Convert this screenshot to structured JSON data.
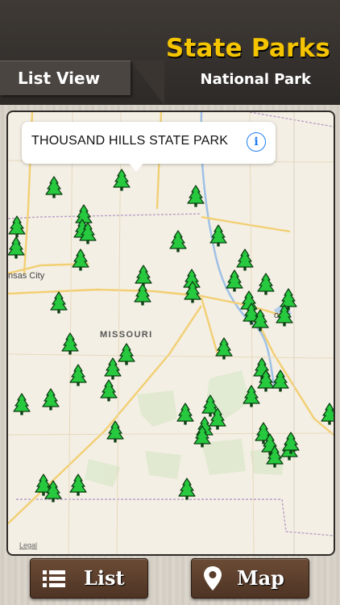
{
  "header": {
    "app_title": "State Parks",
    "subtitle": "National Park",
    "list_view_tab": "List View"
  },
  "map": {
    "callout_title": "THOUSAND HILLS STATE PARK",
    "callout_info_icon": "info-icon",
    "state_label": "MISSOURI",
    "city_labels": [
      "nsas City",
      "ouis"
    ],
    "legal_link": "Legal",
    "park_marker_icon": "tree-icon",
    "park_marker_color": "#27c93f",
    "park_marker_count": 52
  },
  "bottom_bar": {
    "list_button": "List",
    "list_icon": "list-icon",
    "map_button": "Map",
    "map_icon": "location-pin-icon"
  },
  "colors": {
    "title_yellow": "#f5c400",
    "header_dark": "#2e2a27",
    "button_brown": "#5a3d2a"
  }
}
